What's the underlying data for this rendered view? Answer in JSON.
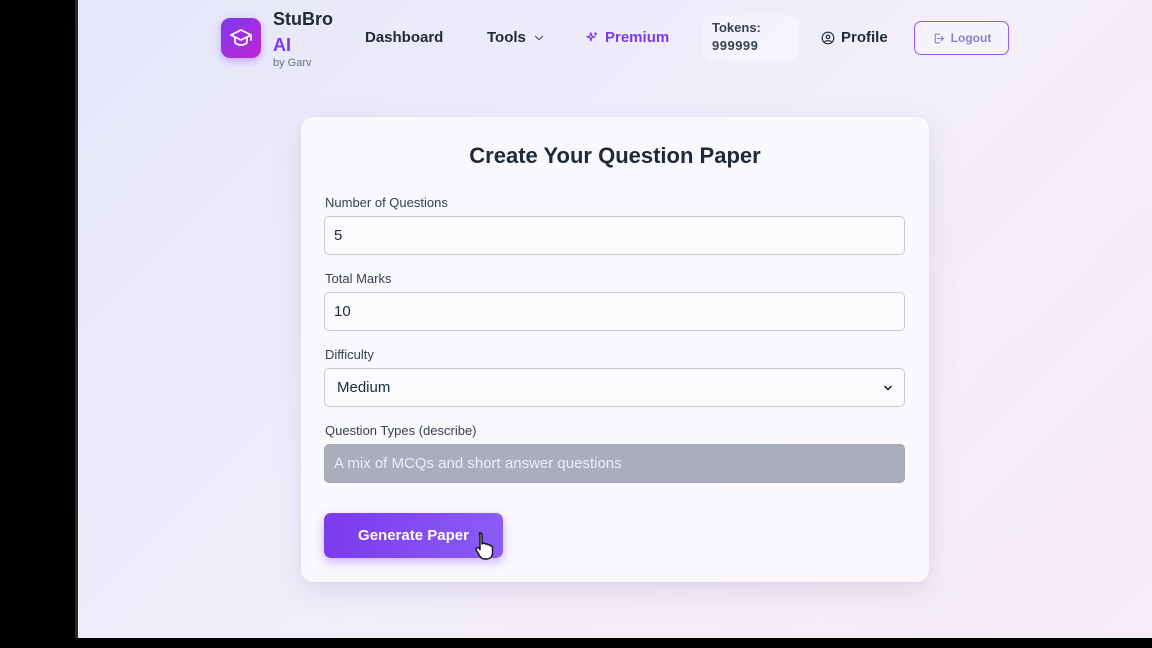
{
  "nav": {
    "brand_line1": "StuBro",
    "brand_line2": "AI",
    "brand_by": "by Garv",
    "dashboard": "Dashboard",
    "tools": "Tools",
    "premium": "Premium",
    "tokens_label": "Tokens:",
    "tokens_value": "999999",
    "profile": "Profile",
    "logout": "Logout"
  },
  "form": {
    "title": "Create Your Question Paper",
    "questions_label": "Number of Questions",
    "questions_value": "5",
    "marks_label": "Total Marks",
    "marks_value": "10",
    "difficulty_label": "Difficulty",
    "difficulty_value": "Medium",
    "types_label": "Question Types (describe)",
    "types_value": "A mix of MCQs and short answer questions",
    "submit": "Generate Paper"
  },
  "colors": {
    "accent": "#7c3aed",
    "brand_gradient_end": "#c026d3"
  },
  "icons": {
    "logo": "graduation-cap-icon",
    "tools_chevron": "chevron-down-icon",
    "premium": "sparkles-icon",
    "profile": "user-circle-icon",
    "logout": "logout-icon",
    "select": "chevron-down-icon",
    "cursor": "hand-pointer-icon"
  }
}
